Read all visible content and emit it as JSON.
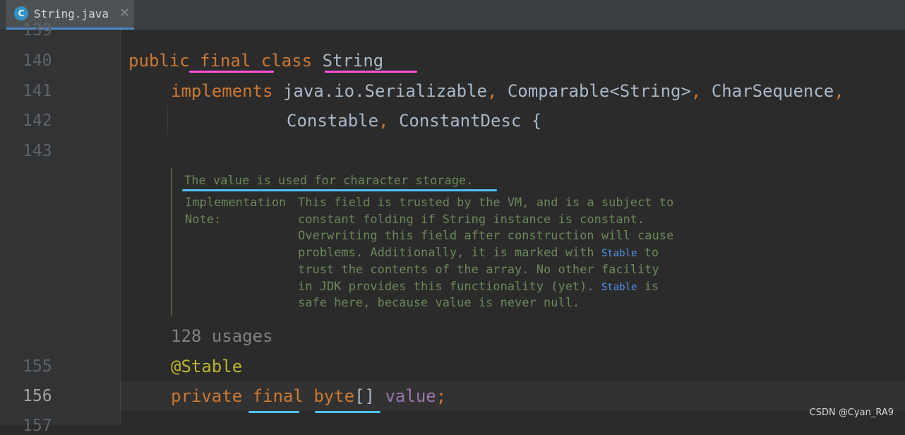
{
  "tab": {
    "icon": "C",
    "title": "String.java",
    "close": "✕"
  },
  "gutter": {
    "lines": [
      "139",
      "140",
      "141",
      "142",
      "143",
      "155",
      "156",
      "157"
    ]
  },
  "code": {
    "l140": {
      "public": "public",
      "final": "final",
      "class": "class",
      "name": "String"
    },
    "l141": {
      "implements": "implements",
      "types": "java.io.Serializable",
      "c1": ",",
      "comparable": "Comparable<String>",
      "c2": ",",
      "charseq": "CharSequence",
      "c3": ","
    },
    "l142": {
      "constable": "Constable",
      "c1": ",",
      "desc": "ConstantDesc",
      "brace": "{"
    },
    "usages": "128 usages",
    "l155": {
      "annotation": "@Stable"
    },
    "l156": {
      "private": "private",
      "final": "final",
      "byte": "byte",
      "brackets": "[]",
      "field": "value",
      "semi": ";"
    }
  },
  "doc": {
    "summary": "The value is used for character storage.",
    "label1": "Implementation",
    "label2": "Note:",
    "body": [
      "This field is trusted by the VM, and is a subject to",
      "constant folding if String instance is constant.",
      "Overwriting this field after construction will cause",
      "problems. Additionally, it is marked with ",
      "trust the contents of the array. No other facility",
      "in JDK provides this functionality (yet). ",
      "safe here, because value is never null."
    ],
    "link1": "Stable",
    "after_link1": " to",
    "link2": "Stable",
    "after_link2": " is"
  },
  "watermark": "CSDN @Cyan_RA9",
  "colors": {
    "keyword": "#cc7832",
    "annotation": "#bbb529",
    "doc": "#6a8759",
    "link": "#5394ec",
    "pink_underline": "#ff52d9",
    "blue_underline": "#4fc3f7"
  }
}
